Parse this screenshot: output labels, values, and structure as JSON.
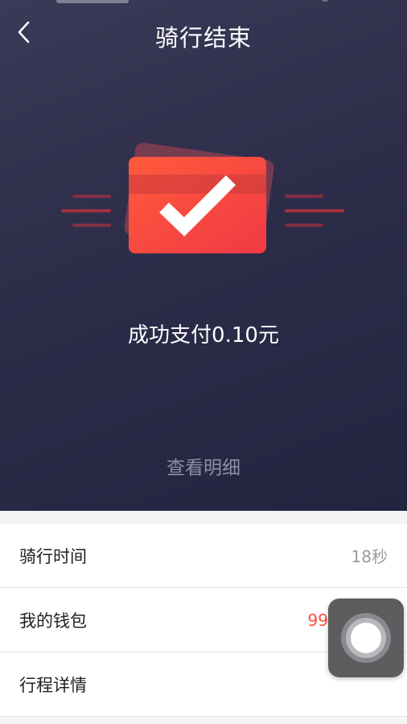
{
  "header": {
    "title": "骑行结束"
  },
  "payment": {
    "message": "成功支付0.10元",
    "detail_link": "查看明细"
  },
  "rows": [
    {
      "label": "骑行时间",
      "value": "18秒"
    },
    {
      "label": "我的钱包",
      "value": "99"
    },
    {
      "label": "行程详情",
      "value": ""
    }
  ],
  "colors": {
    "accent": "#ff4d3c",
    "hero_bg": "#2d2d4a"
  },
  "icons": {
    "back": "chevron-left-icon",
    "status": "card-check-icon",
    "assistive": "assistive-touch-icon"
  }
}
